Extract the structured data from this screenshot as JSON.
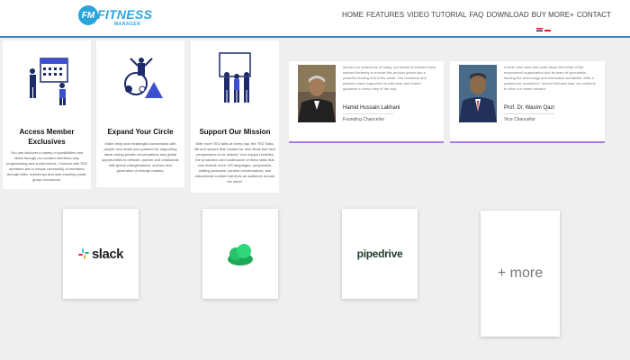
{
  "header": {
    "logo_badge": "FM",
    "logo_word": "FITNESS",
    "logo_sub": "MANAGER",
    "nav": [
      "HOME",
      "FEATURES",
      "VIDEO TUTORIAL",
      "FAQ",
      "DOWNLOAD",
      "BUY MORE+",
      "CONTACT"
    ],
    "languages": [
      "en",
      "ru"
    ]
  },
  "features": [
    {
      "title_line1": "Access Member",
      "title_line2": "Exclusives",
      "text": "You can discover a variety of possibilities and ideas through our curated members-only programming and social events. Connect with TED speakers and a unique community of members through talks, workshops and awe-inspiring small-group excursions."
    },
    {
      "title_line1": "Expand Your Circle",
      "title_line2": "",
      "text": "Make deep and meaningful connections with people who share your passion for supporting ideas during private conversations and global opportunities to network, partner and collaborate with global changemakers, and the next generation of change makers."
    },
    {
      "title_line1": "Support Our Mission",
      "title_line2": "",
      "text": "With more TED talks at every day, the TED Talks, life and spaces that creates for new ideas and new perspectives to be shared. Your support enables the production and sustenance of these talks that now include more 100 languages, perspective-shifting podcasts, curated conversations, and educational content that finds an audience around the world."
    }
  ],
  "founders": [
    {
      "quote": "Across our endeavors of today, our teams of learners have worked tirelessly to ensure this product grows into a powerful leading tool in the world. Our members and partners have supported us with clear and expert guidance in every step of the way.",
      "name": "Hamid Hussain Lakhani",
      "title": "Founding Chancellor"
    },
    {
      "quote": "A fresh new view with pride about the future of the empowered organization and its team of specialists, leading the technology and innovation worldwide. With a passion for excellence, honest skill and trust, we continue to drive our vision forward.",
      "name": "Prof. Dr. Wasim Qazi",
      "title": "Vice Chancellor"
    }
  ],
  "integrations": {
    "slack": "slack",
    "pipedrive": "pipedrive",
    "more": "+ more"
  }
}
